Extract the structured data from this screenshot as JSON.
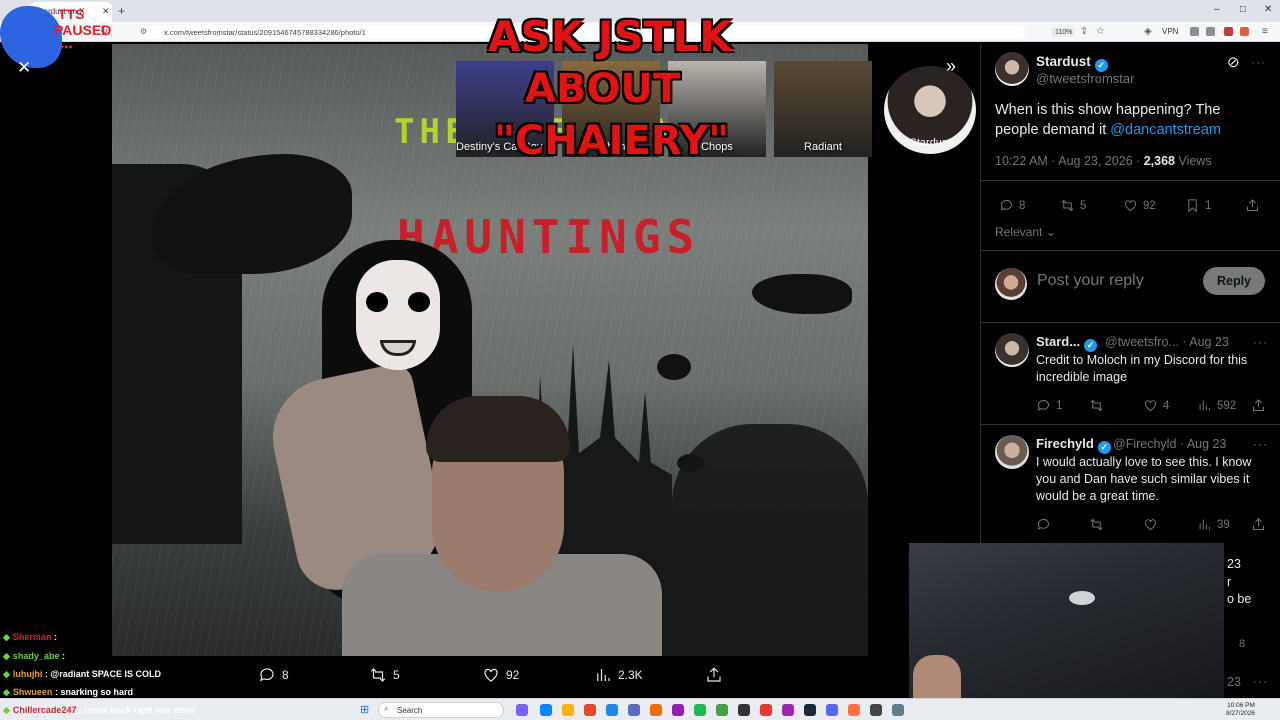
{
  "browser": {
    "tab_title": "Stardust on X",
    "url": "x.com/tweetsfromstar/status/2091546745788334286/photo/1",
    "zoom": "110%",
    "vpn_label": "VPN"
  },
  "tts_overlay": {
    "line1": "TTS",
    "line2": "PAUSED",
    "dots": "•••"
  },
  "ask_overlay": {
    "line1": "ASK JSTLK",
    "line2": "ABOUT",
    "line3": "\"CHAIERY\""
  },
  "media": {
    "title_line1": "THE SPECTRAL",
    "title_line2": "HAUNTINGS"
  },
  "avatar_strip": [
    {
      "label": "Destiny's Cat Boy (Ketchup)",
      "color": "#3e3f8a"
    },
    {
      "label": "Ethan",
      "color": "#8a6a3c"
    },
    {
      "label": "Chops",
      "color": "#b9b4ae"
    },
    {
      "label": "Radiant",
      "color": "#5a4a32"
    }
  ],
  "stardust_avatar_label": "Stardust",
  "media_actions": {
    "replies": "8",
    "reposts": "5",
    "likes": "92",
    "views": "2.3K"
  },
  "tweet": {
    "name": "Stardust",
    "handle": "@tweetsfromstar",
    "text": "When is this show happening? The people demand it ",
    "mention": "@dancantstream",
    "time": "10:22 AM · Aug 23, 2026 · ",
    "views_count": "2,368",
    "views_label": " Views",
    "replies": "8",
    "reposts": "5",
    "likes": "92",
    "bookmarks": "1",
    "sort_label": "Relevant",
    "reply_placeholder": "Post your reply",
    "reply_button": "Reply"
  },
  "replies": [
    {
      "name": "Stard...",
      "handle": "@tweetsfro... · Aug 23",
      "text": "Credit to Moloch in my Discord for this incredible image",
      "replies": "1",
      "reposts": "",
      "likes": "4",
      "views": "592"
    },
    {
      "name": "Firechyld",
      "handle": "@Firechyld · Aug 23",
      "text": "I would actually love to see this. I know you and Dan have such similar vibes it would be a great time.",
      "replies": "",
      "reposts": "",
      "likes": "",
      "views": "39"
    }
  ],
  "partial_right": {
    "date1": "23",
    "frag1": "r",
    "frag2": "o be",
    "count": "8",
    "date2": "23"
  },
  "chat": [
    {
      "user": "Sherman",
      "text": "",
      "user_color": "#c0302a"
    },
    {
      "user": "shady_abe",
      "text": "",
      "user_color": "#6ad23a"
    },
    {
      "user": "luhujhi",
      "text": "@radiant SPACE IS COLD",
      "user_color": "#f0a020"
    },
    {
      "user": "Shwueen",
      "text": "snarking so hard",
      "user_color": "#e0a030"
    },
    {
      "user": "Chillercade247",
      "text": "come back i got one more",
      "user_color": "#c0302a"
    }
  ],
  "taskbar": {
    "search_placeholder": "Search",
    "time": "10:06 PM",
    "date": "8/27/2026"
  }
}
